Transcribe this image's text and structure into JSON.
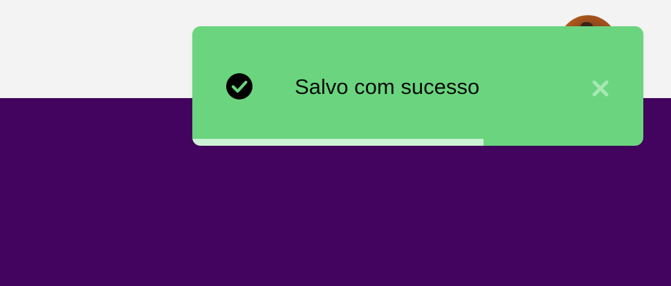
{
  "toast": {
    "message": "Salvo com sucesso",
    "status": "success",
    "icon": "check-circle-icon",
    "close_icon": "close-icon",
    "progress_fraction": 0.645
  },
  "colors": {
    "toast_background": "#6ad57e",
    "progress_fill": "#cdf1d4",
    "page_background": "#42045e",
    "topbar_background": "#f4f3f4"
  }
}
